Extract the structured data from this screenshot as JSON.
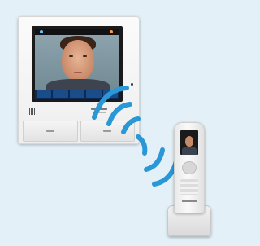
{
  "scene": {
    "background_color": "#e3f0f7",
    "objects": [
      "indoor-video-monitor",
      "wireless-signal-waves",
      "cordless-monitor-handset",
      "charging-cradle"
    ],
    "wave_color": "#2a98d6"
  }
}
